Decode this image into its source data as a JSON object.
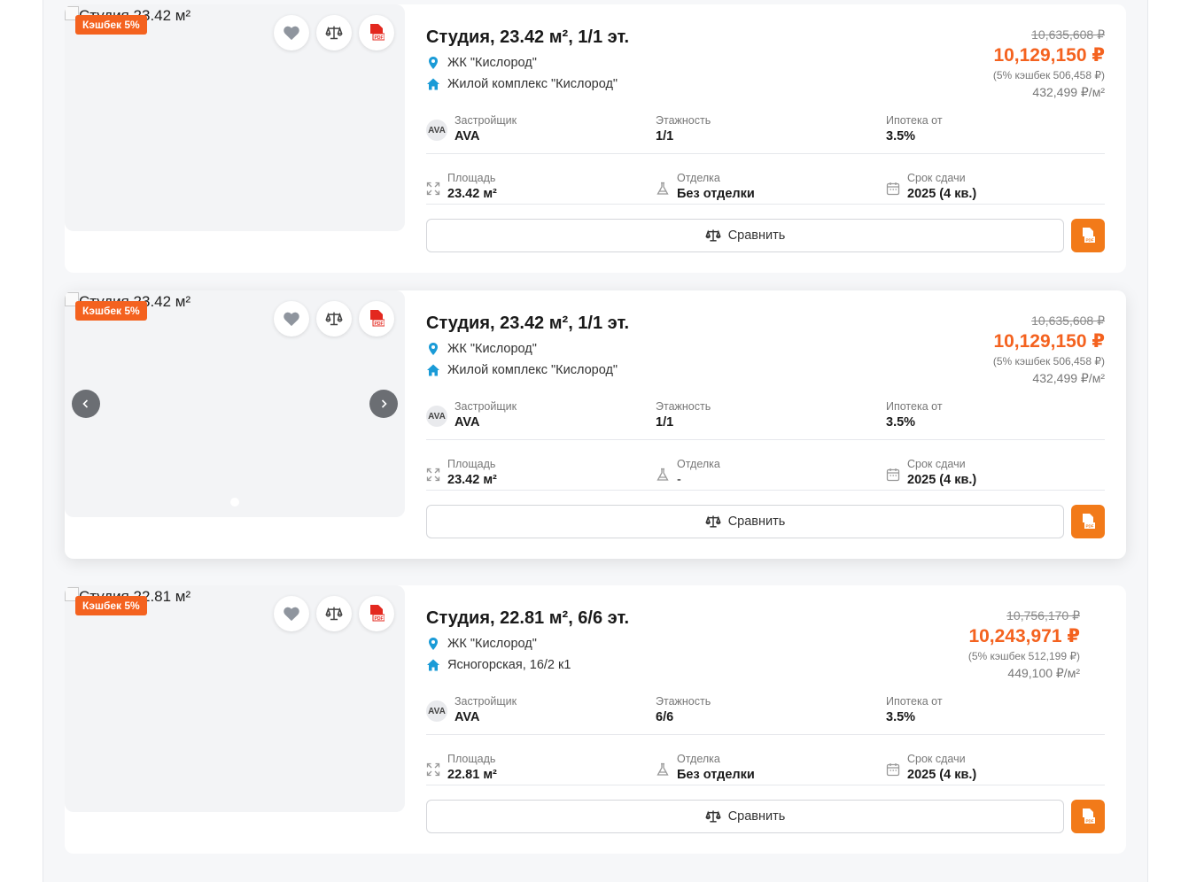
{
  "colors": {
    "accent": "#f4621f",
    "pdf_button": "#f27a19",
    "location_pin": "#1a9bd7"
  },
  "icons": {
    "favorite": "heart-icon",
    "compare": "scales-icon",
    "pdf": "pdf-file-icon",
    "location": "map-pin-icon",
    "address": "home-icon",
    "area": "expand-arrows-icon",
    "finish": "flask-icon",
    "deadline": "calendar-icon"
  },
  "labels": {
    "badge": "Кэшбек 5%",
    "developer": "Застройщик",
    "floors": "Этажность",
    "mortgage": "Ипотека от",
    "area": "Площадь",
    "finish": "Отделка",
    "deadline": "Срок сдачи",
    "compare_button": "Сравнить"
  },
  "listings": [
    {
      "image_alt": "Студия 23.42 м²",
      "title": "Студия, 23.42 м², 1/1 эт.",
      "complex": "ЖК \"Кислород\"",
      "address": "Жилой комплекс \"Кислород\"",
      "old_price": "10,635,608 ₽",
      "price": "10,129,150 ₽",
      "cashback": "(5% кэшбек 506,458 ₽)",
      "price_per_m2": "432,499 ₽/м²",
      "developer_logo": "AVA",
      "developer": "AVA",
      "floors": "1/1",
      "mortgage": "3.5%",
      "area": "23.42 м²",
      "finish": "Без отделки",
      "deadline": "2025 (4 кв.)"
    },
    {
      "image_alt": "Студия 23.42 м²",
      "title": "Студия, 23.42 м², 1/1 эт.",
      "complex": "ЖК \"Кислород\"",
      "address": "Жилой комплекс \"Кислород\"",
      "old_price": "10,635,608 ₽",
      "price": "10,129,150 ₽",
      "cashback": "(5% кэшбек 506,458 ₽)",
      "price_per_m2": "432,499 ₽/м²",
      "developer_logo": "AVA",
      "developer": "AVA",
      "floors": "1/1",
      "mortgage": "3.5%",
      "area": "23.42 м²",
      "finish": "-",
      "deadline": "2025 (4 кв.)"
    },
    {
      "image_alt": "Студия 22.81 м²",
      "title": "Студия, 22.81 м², 6/6 эт.",
      "complex": "ЖК \"Кислород\"",
      "address": "Ясногорская, 16/2 к1",
      "old_price": "10,756,170 ₽",
      "price": "10,243,971 ₽",
      "cashback": "(5% кэшбек 512,199 ₽)",
      "price_per_m2": "449,100 ₽/м²",
      "developer_logo": "AVA",
      "developer": "AVA",
      "floors": "6/6",
      "mortgage": "3.5%",
      "area": "22.81 м²",
      "finish": "Без отделки",
      "deadline": "2025 (4 кв.)"
    }
  ]
}
